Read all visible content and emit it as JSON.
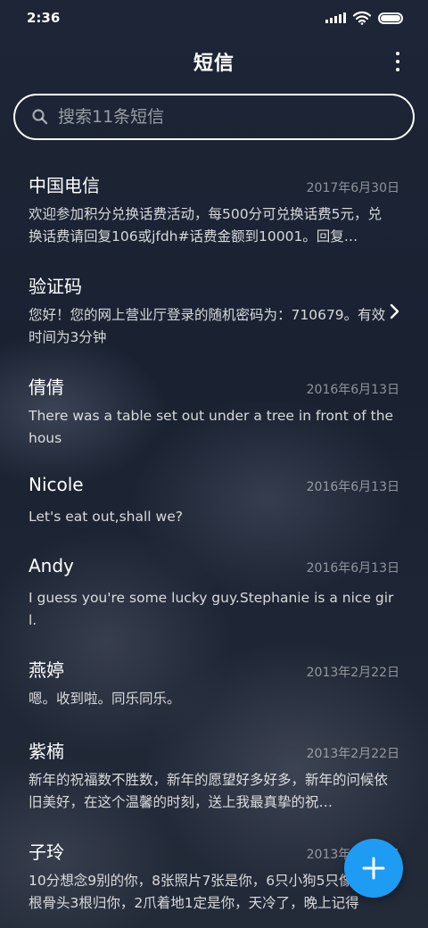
{
  "status_bar": {
    "time": "2:36"
  },
  "header": {
    "title": "短信",
    "more_icon": "more-vertical-icon"
  },
  "search": {
    "placeholder": "搜索11条短信",
    "icon": "search-icon"
  },
  "messages": [
    {
      "sender": "中国电信",
      "date": "2017年6月30日",
      "preview": "欢迎参加积分兑换话费活动，每500分可兑换话费5元，兑换话费请回复106或jfdh#话费金额到10001。回复…"
    },
    {
      "sender": "验证码",
      "date": "",
      "preview": "您好！您的网上营业厅登录的随机密码为：710679。有效时间为3分钟"
    },
    {
      "sender": "倩倩",
      "date": "2016年6月13日",
      "preview": "There was a table set out under a tree in front of the hous"
    },
    {
      "sender": "Nicole",
      "date": "2016年6月13日",
      "preview": "Let's eat out,shall we?"
    },
    {
      "sender": "Andy",
      "date": "2016年6月13日",
      "preview": "I guess you're some lucky guy.Stephanie is a nice girl."
    },
    {
      "sender": "燕婷",
      "date": "2013年2月22日",
      "preview": "嗯。收到啦。同乐同乐。"
    },
    {
      "sender": "紫楠",
      "date": "2013年2月22日",
      "preview": "新年的祝福数不胜数，新年的愿望好多好多，新年的问候依旧美好，在这个温馨的时刻，送上我最真挚的祝…"
    },
    {
      "sender": "子玲",
      "date": "2013年2月22日",
      "preview": "10分想念9别的你，8张照片7张是你，6只小狗5只像你，4根骨头3根归你，2爪着地1定是你，天冷了，晚上记得"
    }
  ],
  "fab": {
    "icon": "plus-icon",
    "color": "#1e9bf3"
  }
}
